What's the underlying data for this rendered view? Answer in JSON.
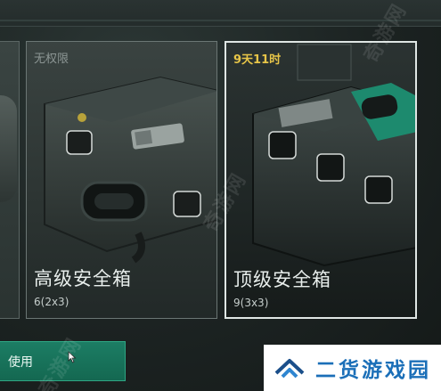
{
  "cards": [
    {
      "name": "高级安全箱",
      "size": "6(2x3)",
      "tag": "无权限",
      "state": "locked"
    },
    {
      "name": "顶级安全箱",
      "size": "9(3x3)",
      "tag": "9天11时",
      "state": "selected"
    }
  ],
  "actions": {
    "use_label": "使用"
  },
  "brand": {
    "name": "二货游戏园"
  },
  "watermark": {
    "text": "奇游网"
  },
  "colors": {
    "accent_green": "#1c7d64",
    "timer_yellow": "#e7c548",
    "brand_blue": "#1b6fb8"
  },
  "icons": [
    "mouse-cursor-icon",
    "brand-logo-icon"
  ]
}
